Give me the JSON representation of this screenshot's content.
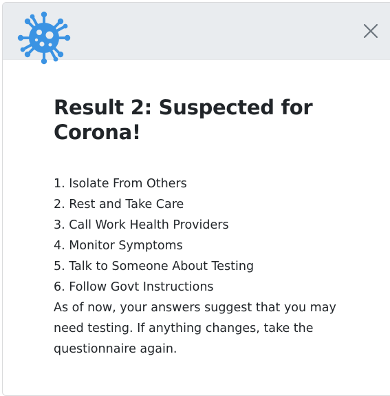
{
  "modal": {
    "logo_icon": "virus-icon",
    "close_icon": "close-icon",
    "title": "Result 2: Suspected for Corona!",
    "steps": [
      "1. Isolate From Others",
      "2. Rest and Take Care",
      "3. Call Work Health Providers",
      "4. Monitor Symptoms",
      "5. Talk to Someone About Testing",
      "6. Follow Govt Instructions"
    ],
    "advice": "As of now, your answers suggest that you may need testing. If anything changes, take the questionnaire again."
  },
  "colors": {
    "header_bg": "#e9ecef",
    "logo_blue": "#3b93e3",
    "text": "#212529",
    "close_icon": "#6c757d"
  }
}
